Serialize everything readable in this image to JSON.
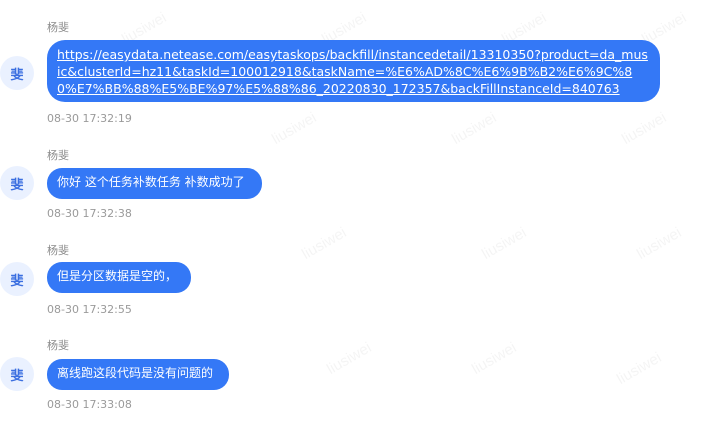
{
  "watermark_text": "liusiwei",
  "messages": [
    {
      "sender": "杨斐",
      "avatar_text": "斐",
      "text": "https://easydata.netease.com/easytaskops/backfill/instancedetail/13310350?product=da_music&clusterId=hz11&taskId=100012918&taskName=%E6%AD%8C%E6%9B%B2%E6%9C%80%E7%BB%88%E5%BE%97%E5%88%86_20220830_172357&backFillInstanceId=840763",
      "time": "08-30 17:32:19"
    },
    {
      "sender": "杨斐",
      "avatar_text": "斐",
      "text": "你好 这个任务补数任务 补数成功了",
      "time": "08-30 17:32:38"
    },
    {
      "sender": "杨斐",
      "avatar_text": "斐",
      "text": "但是分区数据是空的，",
      "time": "08-30 17:32:55"
    },
    {
      "sender": "杨斐",
      "avatar_text": "斐",
      "text": "离线跑这段代码是没有问题的",
      "time": "08-30 17:33:08"
    }
  ],
  "colors": {
    "bubble": "#3478f6",
    "avatar_bg": "#eaf1ff",
    "avatar_text": "#3b6fe0",
    "meta_text": "#9a9a9a"
  }
}
